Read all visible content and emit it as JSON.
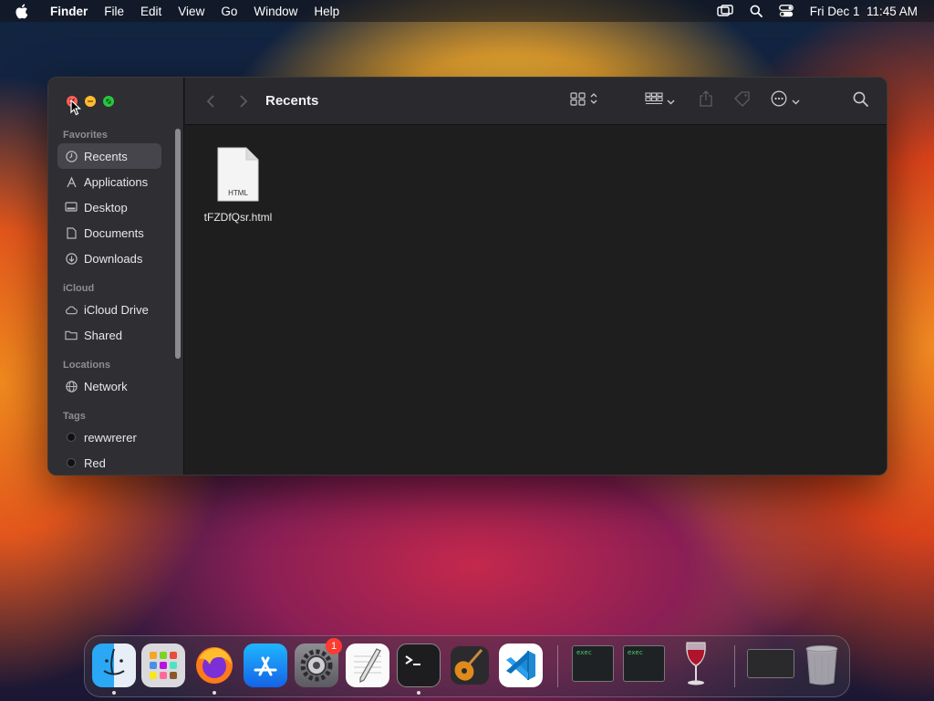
{
  "menubar": {
    "app_name": "Finder",
    "items": [
      "File",
      "Edit",
      "View",
      "Go",
      "Window",
      "Help"
    ],
    "clock": "Fri Dec 1  11:45 AM"
  },
  "window": {
    "title": "Recents",
    "sidebar": {
      "favorites_header": "Favorites",
      "favorites": [
        {
          "label": "Recents",
          "icon": "clock-icon",
          "active": true
        },
        {
          "label": "Applications",
          "icon": "applications-icon"
        },
        {
          "label": "Desktop",
          "icon": "desktop-icon"
        },
        {
          "label": "Documents",
          "icon": "document-icon"
        },
        {
          "label": "Downloads",
          "icon": "download-icon"
        }
      ],
      "icloud_header": "iCloud",
      "icloud": [
        {
          "label": "iCloud Drive",
          "icon": "cloud-icon"
        },
        {
          "label": "Shared",
          "icon": "shared-folder-icon"
        }
      ],
      "locations_header": "Locations",
      "locations": [
        {
          "label": "Network",
          "icon": "globe-icon"
        }
      ],
      "tags_header": "Tags",
      "tags": [
        {
          "label": "rewwrerer"
        },
        {
          "label": "Red"
        }
      ]
    },
    "files": [
      {
        "name": "tFZDfQsr.html",
        "type_label": "HTML"
      }
    ]
  },
  "dock": {
    "apps": [
      "Finder",
      "Launchpad",
      "Firefox",
      "App Store",
      "System Settings",
      "TextEdit",
      "Terminal",
      "GarageBand",
      "Visual Studio Code",
      "exec",
      "exec",
      "Wine",
      "Window",
      "Trash"
    ],
    "settings_badge": "1",
    "exec_label_1": "exec",
    "exec_label_2": "exec"
  },
  "colors": {
    "close": "#ff5f57",
    "minimize": "#febc2e",
    "maximize": "#28c840",
    "badge": "#ff3b30"
  }
}
